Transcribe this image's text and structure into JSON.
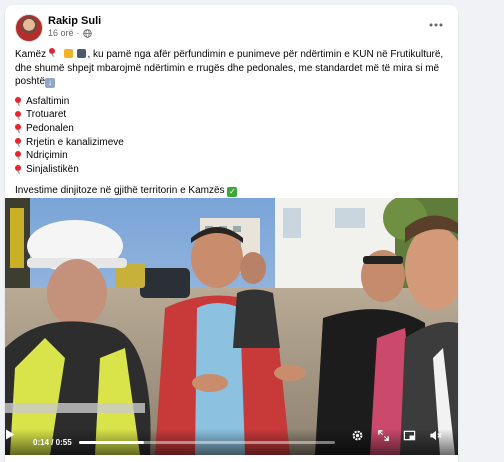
{
  "post": {
    "author": "Rakip Suli",
    "time": "16 orë",
    "text_line1": "Kamëz",
    "text_rest": "ku pamë nga afër përfundimin e punimeve për ndërtimin e KUN në Frutikulturë, dhe shumë shpejt mbarojmë ndërtimin e rrugës dhe pedonales, me standardet më të mira si më poshtë",
    "items": [
      {
        "label": "Asfaltimin"
      },
      {
        "label": "Trotuaret"
      },
      {
        "label": "Pedonalen"
      },
      {
        "label": "Rrjetin e kanalizimeve"
      },
      {
        "label": "Ndriçimin"
      },
      {
        "label": "Sinjalistikën"
      }
    ],
    "closing": "Investime dinjitoze në gjithë territorin e Kamzës"
  },
  "video": {
    "current_time": "0:14",
    "duration": "0:55",
    "time_display": "0:14 / 0:55",
    "progress": 0.255
  },
  "icons": {
    "more": "more-horizontal-icon",
    "privacy": "globe-icon",
    "play": "play-icon",
    "settings": "gear-icon",
    "fullscreen": "expand-icon",
    "pip": "picture-in-picture-icon",
    "volume": "volume-icon"
  },
  "colors": {
    "background": "#f0f2f5",
    "card": "#ffffff",
    "text": "#050505",
    "secondary": "#65676b",
    "pin": "#e4252e",
    "check": "#3aaa35"
  }
}
